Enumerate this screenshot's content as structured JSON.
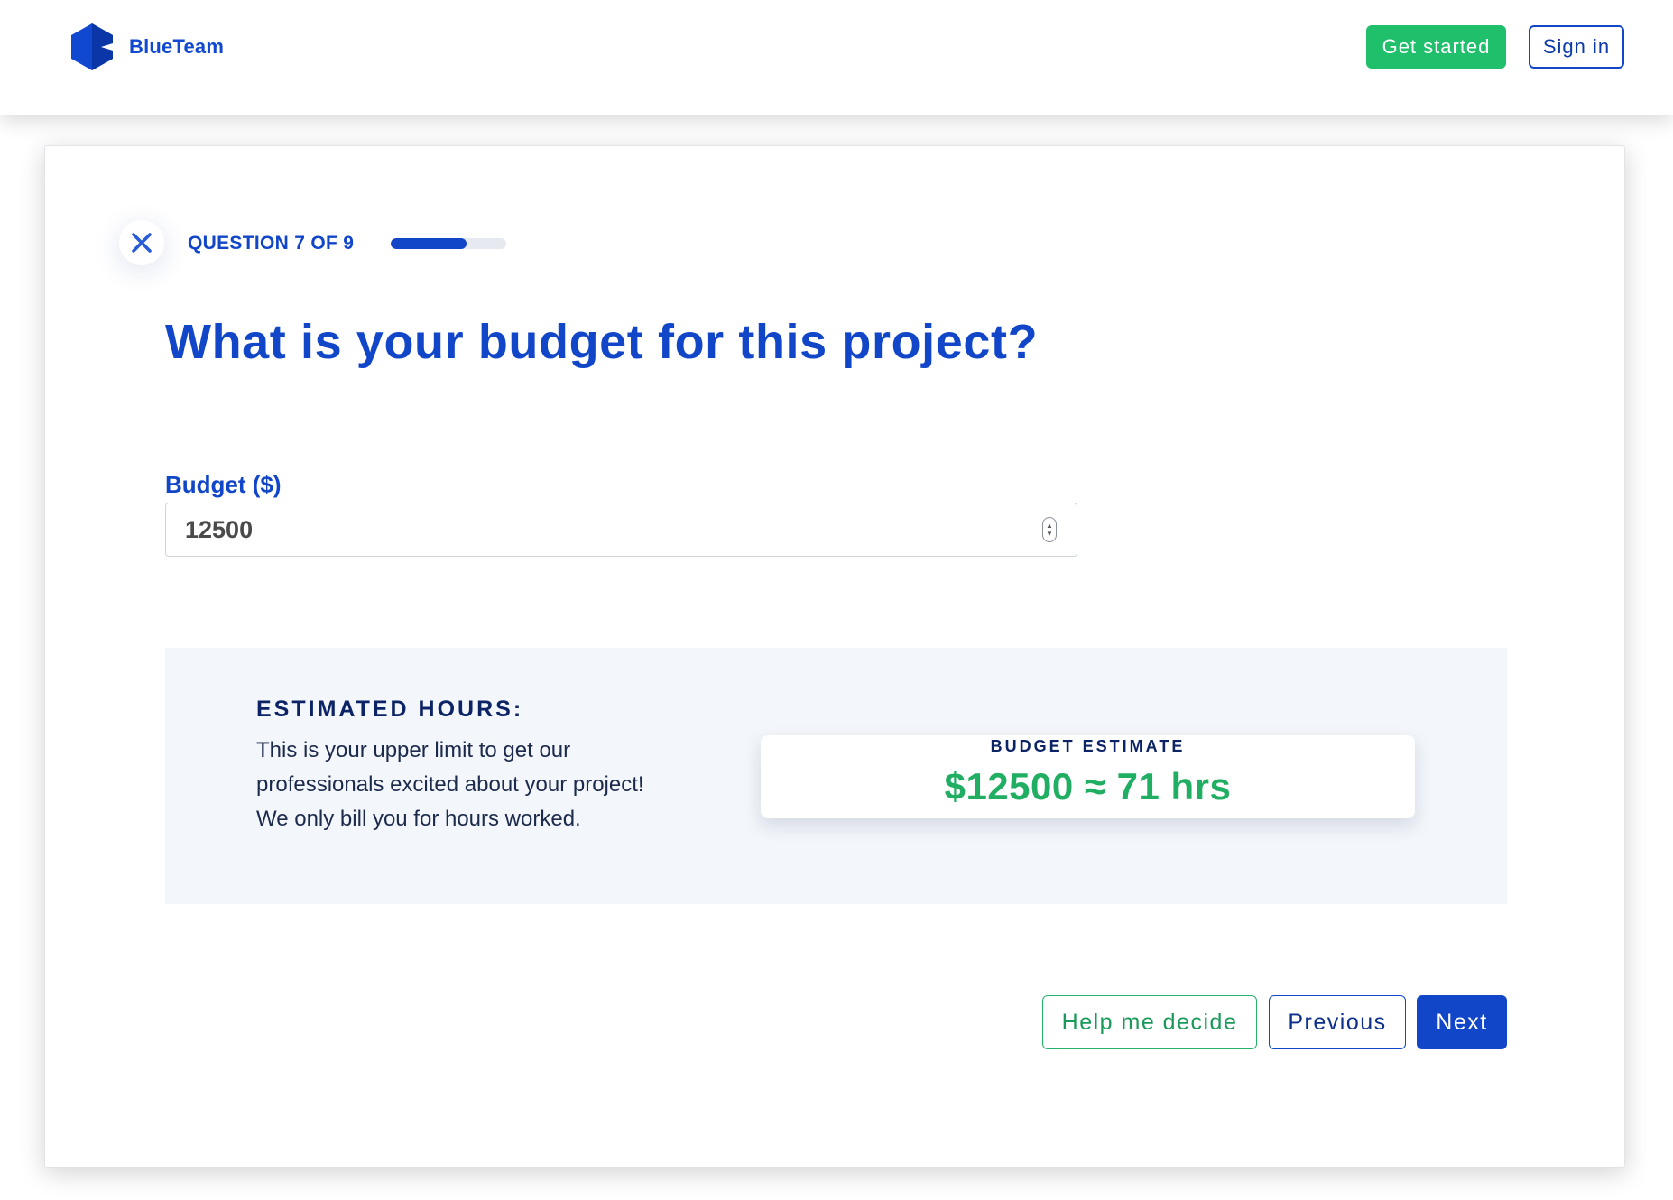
{
  "header": {
    "brand": "BlueTeam",
    "logo_icon": "blueteam-logo-icon",
    "get_started_label": "Get started",
    "sign_in_label": "Sign in"
  },
  "quiz": {
    "close_icon": "close-icon",
    "progress_label": "QUESTION 7 OF 9",
    "progress_fraction": 0.66,
    "question": "What is your budget for this project?",
    "field_label": "Budget ($)",
    "budget_value": "12500"
  },
  "estimate": {
    "heading": "ESTIMATED HOURS:",
    "description": "This is your upper limit to get our professionals excited about your project! We only bill you for hours worked.",
    "box_label": "BUDGET ESTIMATE",
    "box_value": "$12500 ≈ 71 hrs"
  },
  "actions": {
    "help_label": "Help me decide",
    "previous_label": "Previous",
    "next_label": "Next"
  },
  "colors": {
    "brand_blue": "#1146c9",
    "navy": "#0c2466",
    "green": "#1fbf6b",
    "panel_bg": "#f3f6fa"
  }
}
